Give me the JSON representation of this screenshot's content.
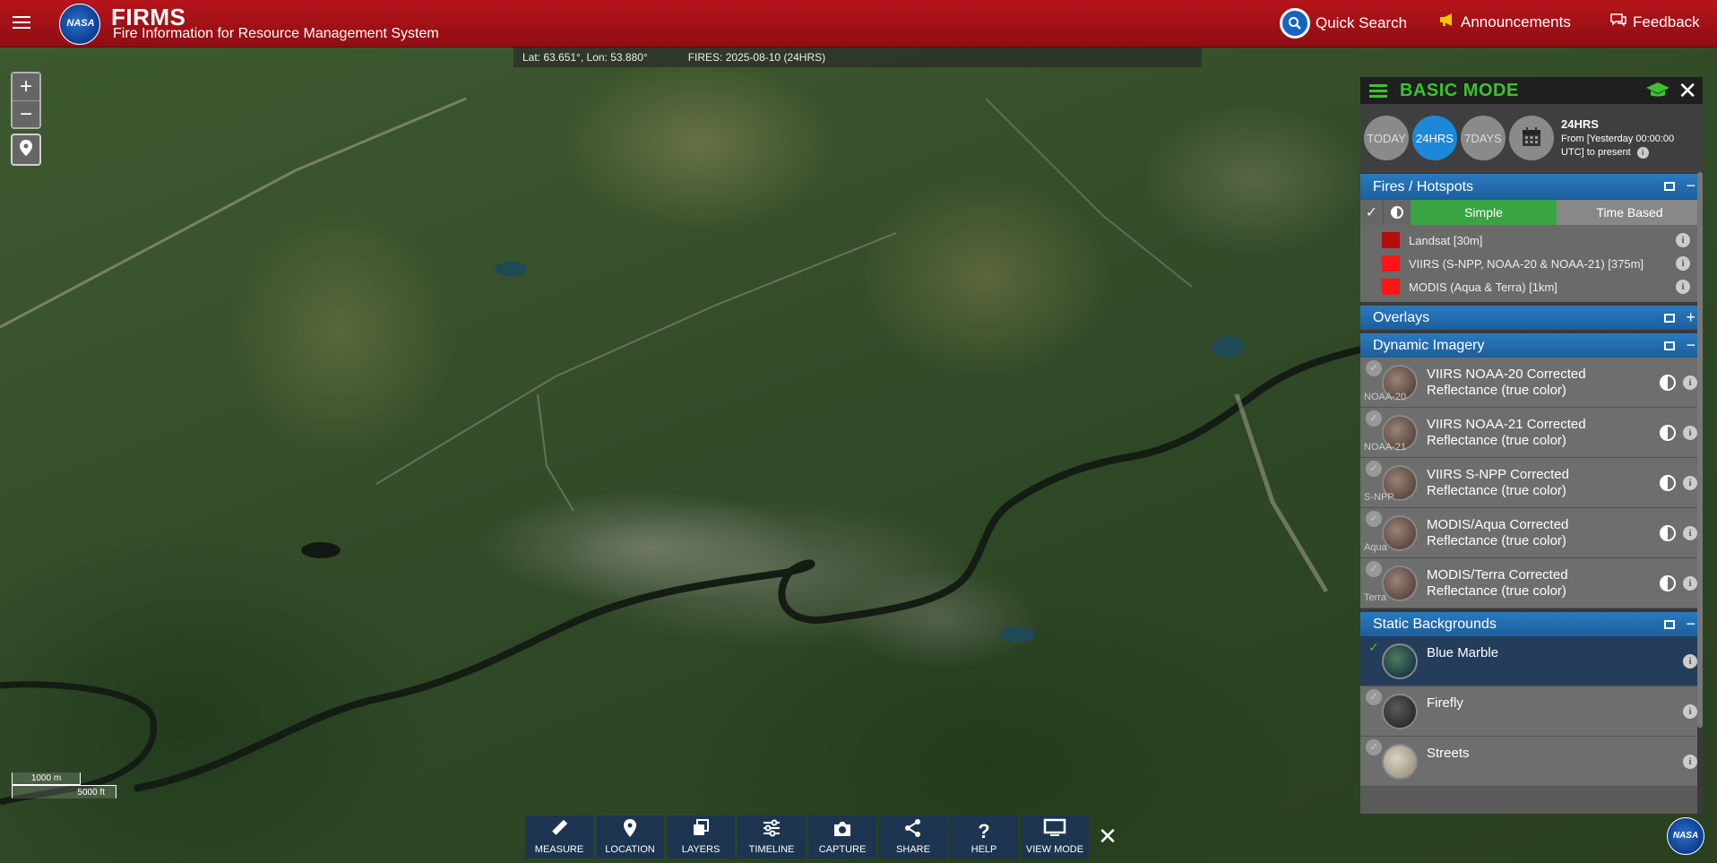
{
  "header": {
    "title": "FIRMS",
    "subtitle": "Fire Information for Resource Management System",
    "logo_text": "NASA",
    "quick_search": "Quick Search",
    "announcements": "Announcements",
    "feedback": "Feedback"
  },
  "coords": {
    "latlon": "Lat: 63.651°, Lon: 53.880°",
    "fires": "FIRES: 2025-08-10 (24HRS)"
  },
  "scale": {
    "metric": "1000 m",
    "imperial": "5000 ft"
  },
  "toolbar": {
    "items": [
      {
        "label": "MEASURE"
      },
      {
        "label": "LOCATION"
      },
      {
        "label": "LAYERS"
      },
      {
        "label": "TIMELINE"
      },
      {
        "label": "CAPTURE"
      },
      {
        "label": "SHARE"
      },
      {
        "label": "HELP"
      },
      {
        "label": "VIEW MODE"
      }
    ]
  },
  "panel": {
    "mode_title": "BASIC MODE",
    "time_buttons": [
      "TODAY",
      "24HRS",
      "7DAYS"
    ],
    "active_time": "24HRS",
    "time_info": {
      "range": "24HRS",
      "line1": "From [Yesterday 00:00:00",
      "line2": "UTC] to present"
    },
    "fires_section": {
      "title": "Fires / Hotspots",
      "modes": [
        "Simple",
        "Time Based"
      ],
      "items": [
        {
          "label": "Landsat [30m]",
          "color": "#b30e0e"
        },
        {
          "label": "VIIRS (S-NPP, NOAA-20 & NOAA-21) [375m]",
          "color": "#ff1515"
        },
        {
          "label": "MODIS (Aqua & Terra) [1km]",
          "color": "#ff1515"
        }
      ]
    },
    "overlays_section": {
      "title": "Overlays"
    },
    "dynamic_section": {
      "title": "Dynamic Imagery",
      "items": [
        {
          "tag": "NOAA-20",
          "line1": "VIIRS NOAA-20 Corrected",
          "line2": "Reflectance (true color)"
        },
        {
          "tag": "NOAA-21",
          "line1": "VIIRS NOAA-21 Corrected",
          "line2": "Reflectance (true color)"
        },
        {
          "tag": "S-NPP",
          "line1": "VIIRS S-NPP Corrected",
          "line2": "Reflectance (true color)"
        },
        {
          "tag": "Aqua",
          "line1": "MODIS/Aqua Corrected",
          "line2": "Reflectance (true color)"
        },
        {
          "tag": "Terra",
          "line1": "MODIS/Terra Corrected",
          "line2": "Reflectance (true color)"
        }
      ]
    },
    "static_section": {
      "title": "Static Backgrounds",
      "items": [
        {
          "label": "Blue Marble",
          "selected": true
        },
        {
          "label": "Firefly",
          "selected": false
        },
        {
          "label": "Streets",
          "selected": false
        }
      ]
    }
  },
  "icons": {
    "info": "i",
    "check": "✓",
    "close": "✕",
    "plus": "+",
    "minus": "−"
  }
}
